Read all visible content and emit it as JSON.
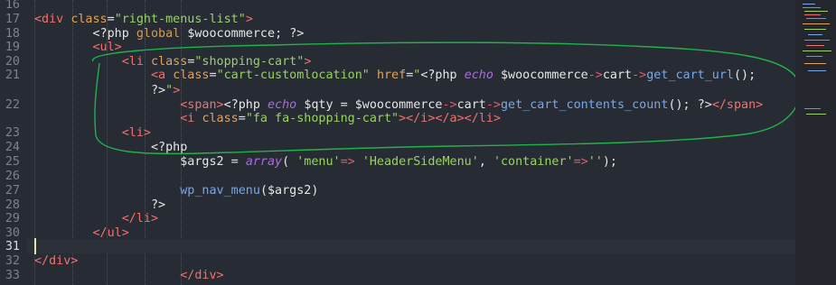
{
  "editor": {
    "line_numbers": [
      "16",
      "17",
      "18",
      "19",
      "20",
      "21",
      "",
      "22",
      "",
      "23",
      "24",
      "25",
      "26",
      "27",
      "28",
      "29",
      "30",
      "31",
      "32",
      "33"
    ],
    "current_line": "31",
    "lines": [
      {
        "n": "16",
        "segments": []
      },
      {
        "n": "17",
        "segments": [
          [
            "tag",
            "<div"
          ],
          [
            "txt",
            " "
          ],
          [
            "attr",
            "class"
          ],
          [
            "txt",
            "="
          ],
          [
            "str",
            "\"right-menus-list\""
          ],
          [
            "tag",
            ">"
          ]
        ]
      },
      {
        "n": "18",
        "segments": [
          [
            "txt",
            "        "
          ],
          [
            "php",
            "<?php "
          ],
          [
            "kw",
            "global"
          ],
          [
            "txt",
            " "
          ],
          [
            "var",
            "$woocommerce"
          ],
          [
            "txt",
            "; "
          ],
          [
            "php",
            "?>"
          ]
        ]
      },
      {
        "n": "19",
        "segments": [
          [
            "txt",
            "        "
          ],
          [
            "tag",
            "<ul>"
          ]
        ]
      },
      {
        "n": "20",
        "segments": [
          [
            "txt",
            "            "
          ],
          [
            "tag",
            "<li"
          ],
          [
            "txt",
            " "
          ],
          [
            "attr",
            "class"
          ],
          [
            "txt",
            "="
          ],
          [
            "str",
            "\"shopping-cart\""
          ],
          [
            "tag",
            ">"
          ]
        ]
      },
      {
        "n": "21",
        "segments": [
          [
            "txt",
            "                "
          ],
          [
            "tag",
            "<a"
          ],
          [
            "txt",
            " "
          ],
          [
            "attr",
            "class"
          ],
          [
            "txt",
            "="
          ],
          [
            "str",
            "\"cart-customlocation\""
          ],
          [
            "txt",
            " "
          ],
          [
            "attr",
            "href"
          ],
          [
            "txt",
            "="
          ],
          [
            "str",
            "\""
          ],
          [
            "php",
            "<?php "
          ],
          [
            "it",
            "echo"
          ],
          [
            "txt",
            " "
          ],
          [
            "var",
            "$woocommerce"
          ],
          [
            "op",
            "->"
          ],
          [
            "txt",
            "cart"
          ],
          [
            "op",
            "->"
          ],
          [
            "fn",
            "get_cart_url"
          ],
          [
            "txt",
            "();"
          ]
        ]
      },
      {
        "n": "",
        "segments": [
          [
            "txt",
            "                "
          ],
          [
            "php",
            "?>"
          ],
          [
            "str",
            "\""
          ],
          [
            "tag",
            ">"
          ]
        ]
      },
      {
        "n": "22",
        "segments": [
          [
            "txt",
            "                    "
          ],
          [
            "tag",
            "<span>"
          ],
          [
            "php",
            "<?php "
          ],
          [
            "it",
            "echo"
          ],
          [
            "txt",
            " "
          ],
          [
            "var",
            "$qty"
          ],
          [
            "txt",
            " = "
          ],
          [
            "var",
            "$woocommerce"
          ],
          [
            "op",
            "->"
          ],
          [
            "txt",
            "cart"
          ],
          [
            "op",
            "->"
          ],
          [
            "fn",
            "get_cart_contents_count"
          ],
          [
            "txt",
            "(); "
          ],
          [
            "php",
            "?>"
          ],
          [
            "tag",
            "</span>"
          ]
        ]
      },
      {
        "n": "",
        "segments": [
          [
            "txt",
            "                    "
          ],
          [
            "tag",
            "<i"
          ],
          [
            "txt",
            " "
          ],
          [
            "attr",
            "class"
          ],
          [
            "txt",
            "="
          ],
          [
            "str",
            "\"fa fa-shopping-cart\""
          ],
          [
            "tag",
            "></i></a></li>"
          ]
        ]
      },
      {
        "n": "23",
        "segments": [
          [
            "txt",
            "            "
          ],
          [
            "tag",
            "<li>"
          ]
        ]
      },
      {
        "n": "24",
        "segments": [
          [
            "txt",
            "                "
          ],
          [
            "php",
            "<?php"
          ]
        ]
      },
      {
        "n": "25",
        "segments": [
          [
            "txt",
            "                    "
          ],
          [
            "var",
            "$args2"
          ],
          [
            "txt",
            " = "
          ],
          [
            "it",
            "array"
          ],
          [
            "txt",
            "( "
          ],
          [
            "str",
            "'menu'"
          ],
          [
            "op",
            "=>"
          ],
          [
            "txt",
            " "
          ],
          [
            "str",
            "'HeaderSideMenu'"
          ],
          [
            "txt",
            ", "
          ],
          [
            "str",
            "'container'"
          ],
          [
            "op",
            "=>"
          ],
          [
            "str",
            "''"
          ],
          [
            "txt",
            ");"
          ]
        ]
      },
      {
        "n": "26",
        "segments": []
      },
      {
        "n": "27",
        "segments": [
          [
            "txt",
            "                    "
          ],
          [
            "fn",
            "wp_nav_menu"
          ],
          [
            "txt",
            "("
          ],
          [
            "var",
            "$args2"
          ],
          [
            "txt",
            ")"
          ]
        ]
      },
      {
        "n": "28",
        "segments": [
          [
            "txt",
            "                "
          ],
          [
            "php",
            "?>"
          ]
        ]
      },
      {
        "n": "29",
        "segments": [
          [
            "txt",
            "            "
          ],
          [
            "tag",
            "</li>"
          ]
        ]
      },
      {
        "n": "30",
        "segments": [
          [
            "txt",
            "        "
          ],
          [
            "tag",
            "</ul>"
          ]
        ]
      },
      {
        "n": "31",
        "segments": []
      },
      {
        "n": "32",
        "segments": [
          [
            "tag",
            "</div>"
          ]
        ]
      },
      {
        "n": "33",
        "segments": [
          [
            "txt",
            "                    "
          ],
          [
            "tag",
            "</div>"
          ]
        ]
      }
    ]
  },
  "annotation": {
    "color": "#22b14c",
    "shape": "hand-drawn-ellipse"
  },
  "colors": {
    "background": "#272b33",
    "tag": "#f0716f",
    "attr": "#e1a45f",
    "string": "#9bd06b",
    "function": "#7aa7e6",
    "italic_keyword": "#a86fd8"
  }
}
